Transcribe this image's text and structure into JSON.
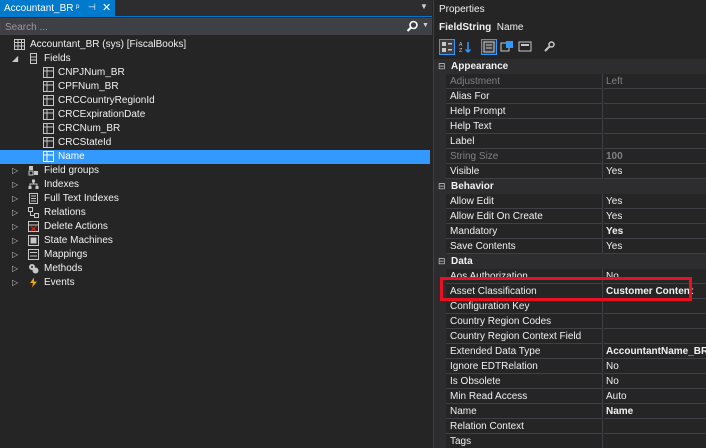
{
  "document_tab": {
    "title": "Accountant_BR",
    "pin_glyph": "ᵖ",
    "pin2_glyph": "⊣",
    "close_glyph": "✕"
  },
  "search": {
    "placeholder": "Search ..."
  },
  "tree": {
    "root": {
      "label": "Accountant_BR (sys) [FiscalBooks]"
    },
    "fields_node": {
      "label": "Fields"
    },
    "fields": [
      {
        "label": "CNPJNum_BR"
      },
      {
        "label": "CPFNum_BR"
      },
      {
        "label": "CRCCountryRegionId"
      },
      {
        "label": "CRCExpirationDate"
      },
      {
        "label": "CRCNum_BR"
      },
      {
        "label": "CRCStateId"
      },
      {
        "label": "Name",
        "selected": true
      }
    ],
    "groups": [
      {
        "label": "Field groups",
        "icon": "field-groups-icon"
      },
      {
        "label": "Indexes",
        "icon": "indexes-icon"
      },
      {
        "label": "Full Text Indexes",
        "icon": "full-text-indexes-icon"
      },
      {
        "label": "Relations",
        "icon": "relations-icon"
      },
      {
        "label": "Delete Actions",
        "icon": "delete-actions-icon"
      },
      {
        "label": "State Machines",
        "icon": "state-machines-icon"
      },
      {
        "label": "Mappings",
        "icon": "mappings-icon"
      },
      {
        "label": "Methods",
        "icon": "methods-icon"
      },
      {
        "label": "Events",
        "icon": "events-icon"
      }
    ]
  },
  "properties": {
    "title": "Properties",
    "object_type": "FieldString",
    "object_name": "Name",
    "categories": [
      {
        "name": "Appearance",
        "rows": [
          {
            "name": "Adjustment",
            "value": "Left",
            "dim": true
          },
          {
            "name": "Alias For",
            "value": ""
          },
          {
            "name": "Help Prompt",
            "value": ""
          },
          {
            "name": "Help Text",
            "value": ""
          },
          {
            "name": "Label",
            "value": ""
          },
          {
            "name": "String Size",
            "value": "100",
            "dim": true,
            "bold": true
          },
          {
            "name": "Visible",
            "value": "Yes"
          }
        ]
      },
      {
        "name": "Behavior",
        "rows": [
          {
            "name": "Allow Edit",
            "value": "Yes"
          },
          {
            "name": "Allow Edit On Create",
            "value": "Yes"
          },
          {
            "name": "Mandatory",
            "value": "Yes",
            "bold": true
          },
          {
            "name": "Save Contents",
            "value": "Yes"
          }
        ]
      },
      {
        "name": "Data",
        "rows": [
          {
            "name": "Aos Authorization",
            "value": "No"
          },
          {
            "name": "Asset Classification",
            "value": "Customer Content",
            "bold": true
          },
          {
            "name": "Configuration Key",
            "value": ""
          },
          {
            "name": "Country Region Codes",
            "value": ""
          },
          {
            "name": "Country Region Context Field",
            "value": ""
          },
          {
            "name": "Extended Data Type",
            "value": "AccountantName_BR",
            "bold": true
          },
          {
            "name": "Ignore EDTRelation",
            "value": "No"
          },
          {
            "name": "Is Obsolete",
            "value": "No"
          },
          {
            "name": "Min Read Access",
            "value": "Auto"
          },
          {
            "name": "Name",
            "value": "Name",
            "bold": true
          },
          {
            "name": "Relation Context",
            "value": ""
          },
          {
            "name": "Tags",
            "value": ""
          }
        ]
      }
    ]
  },
  "colors": {
    "selection": "#3399ff",
    "accent": "#007acc",
    "highlight_box": "#e81123"
  }
}
